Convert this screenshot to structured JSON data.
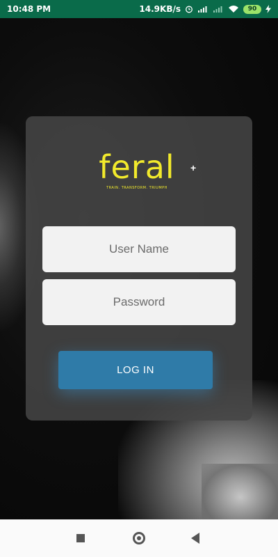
{
  "status_bar": {
    "time": "10:48 PM",
    "net_speed": "14.9KB/s",
    "battery_level": "90",
    "icons": [
      "alarm-icon",
      "signal-4g-icon",
      "signal-icon",
      "wifi-icon",
      "battery-icon",
      "charging-icon"
    ]
  },
  "brand": {
    "wordmark": "feral",
    "tagline": "TRAIN. TRANSFORM. TRIUMPH",
    "accent_color": "#f2ea2c"
  },
  "form": {
    "username_placeholder": "User Name",
    "password_placeholder": "Password",
    "login_label": "LOG IN",
    "button_color": "#2f7ba8"
  },
  "colors": {
    "status_bar": "#0a6b4a"
  }
}
